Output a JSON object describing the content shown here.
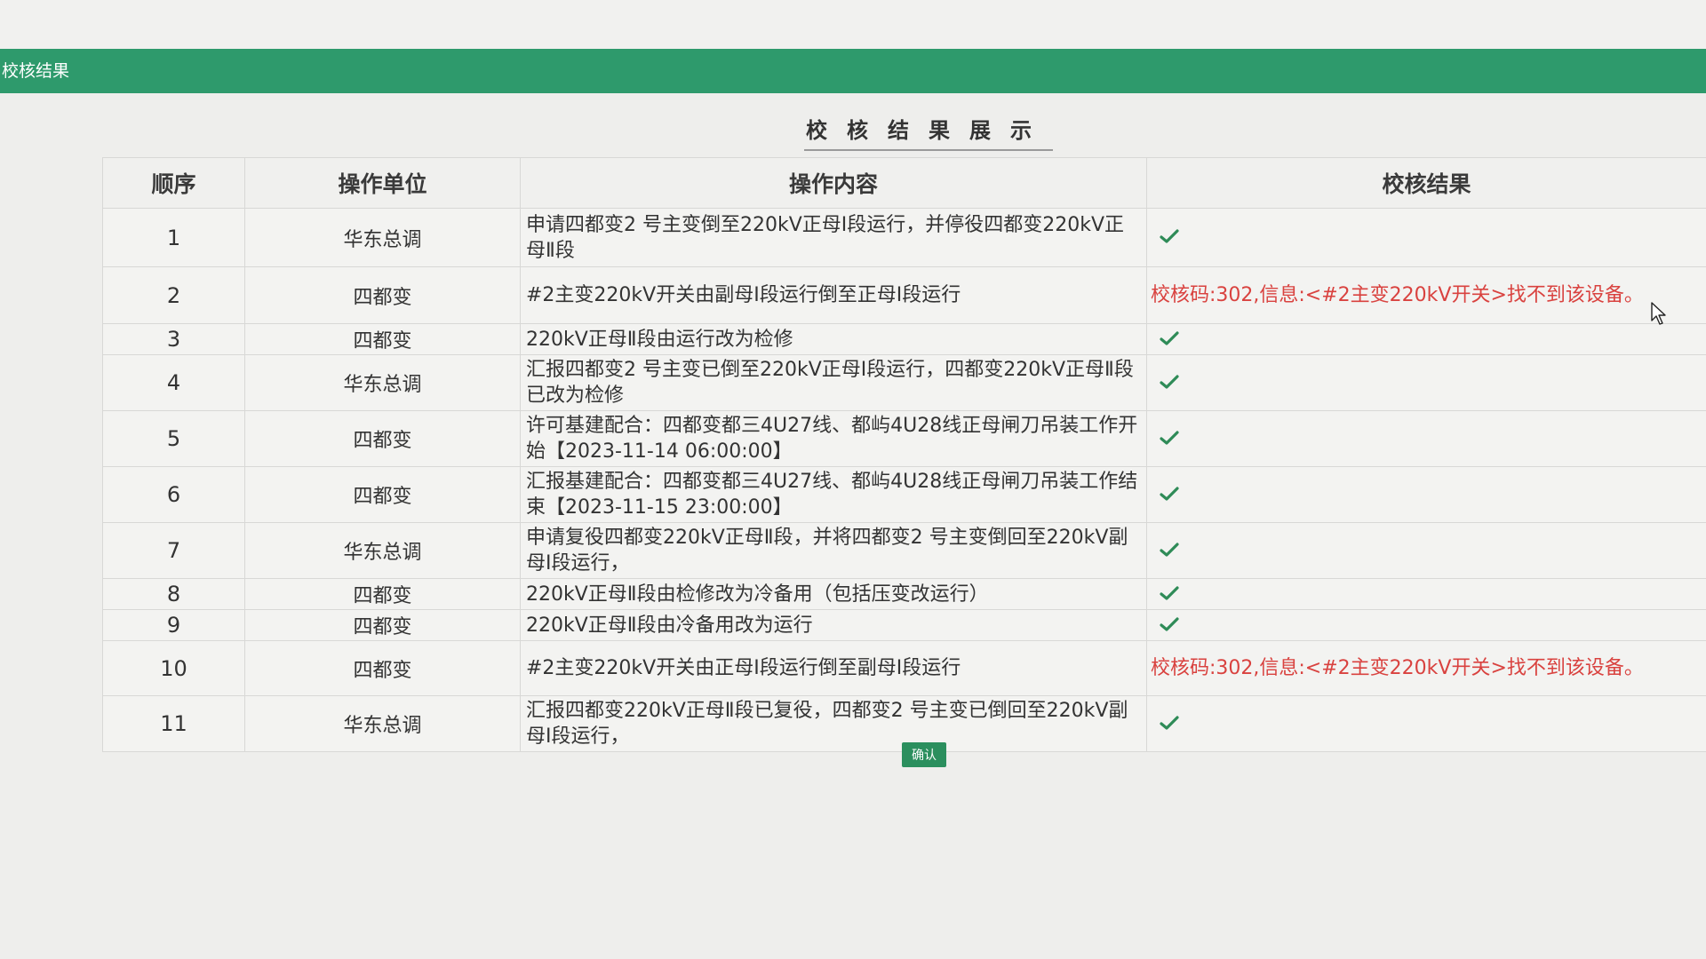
{
  "window": {
    "title": "校核结果"
  },
  "page": {
    "title": "校核结果展示"
  },
  "table": {
    "headers": {
      "seq": "顺序",
      "unit": "操作单位",
      "content": "操作内容",
      "result": "校核结果"
    },
    "rows": [
      {
        "seq": "1",
        "unit": "华东总调",
        "content": "申请四都变2 号主变倒至220kV正母Ⅰ段运行，并停役四都变220kV正母Ⅱ段",
        "result_type": "ok",
        "result": ""
      },
      {
        "seq": "2",
        "unit": "四都变",
        "content": "#2主变220kV开关由副母Ⅰ段运行倒至正母Ⅰ段运行",
        "result_type": "error",
        "result": "校核码:302,信息:<#2主变220kV开关>找不到该设备。"
      },
      {
        "seq": "3",
        "unit": "四都变",
        "content": "220kV正母Ⅱ段由运行改为检修",
        "result_type": "ok",
        "result": ""
      },
      {
        "seq": "4",
        "unit": "华东总调",
        "content": "汇报四都变2 号主变已倒至220kV正母Ⅰ段运行，四都变220kV正母Ⅱ段已改为检修",
        "result_type": "ok",
        "result": ""
      },
      {
        "seq": "5",
        "unit": "四都变",
        "content": "许可基建配合：四都变都三4U27线、都屿4U28线正母闸刀吊装工作开始【2023-11-14 06:00:00】",
        "result_type": "ok",
        "result": ""
      },
      {
        "seq": "6",
        "unit": "四都变",
        "content": "汇报基建配合：四都变都三4U27线、都屿4U28线正母闸刀吊装工作结束【2023-11-15 23:00:00】",
        "result_type": "ok",
        "result": ""
      },
      {
        "seq": "7",
        "unit": "华东总调",
        "content": "申请复役四都变220kV正母Ⅱ段，并将四都变2 号主变倒回至220kV副母Ⅰ段运行，",
        "result_type": "ok",
        "result": ""
      },
      {
        "seq": "8",
        "unit": "四都变",
        "content": "220kV正母Ⅱ段由检修改为冷备用（包括压变改运行）",
        "result_type": "ok",
        "result": ""
      },
      {
        "seq": "9",
        "unit": "四都变",
        "content": "220kV正母Ⅱ段由冷备用改为运行",
        "result_type": "ok",
        "result": ""
      },
      {
        "seq": "10",
        "unit": "四都变",
        "content": "#2主变220kV开关由正母Ⅰ段运行倒至副母Ⅰ段运行",
        "result_type": "error",
        "result": "校核码:302,信息:<#2主变220kV开关>找不到该设备。"
      },
      {
        "seq": "11",
        "unit": "华东总调",
        "content": "汇报四都变220kV正母Ⅱ段已复役，四都变2 号主变已倒回至220kV副母Ⅰ段运行，",
        "result_type": "ok",
        "result": ""
      }
    ]
  },
  "actions": {
    "confirm_label": "确认"
  },
  "colors": {
    "header_bar": "#2e9a6c",
    "check": "#2e8b57",
    "error": "#d9423f",
    "confirm_button": "#2b8f5e"
  },
  "icons": {
    "ok": "check-icon",
    "cursor": "mouse-pointer-icon"
  }
}
